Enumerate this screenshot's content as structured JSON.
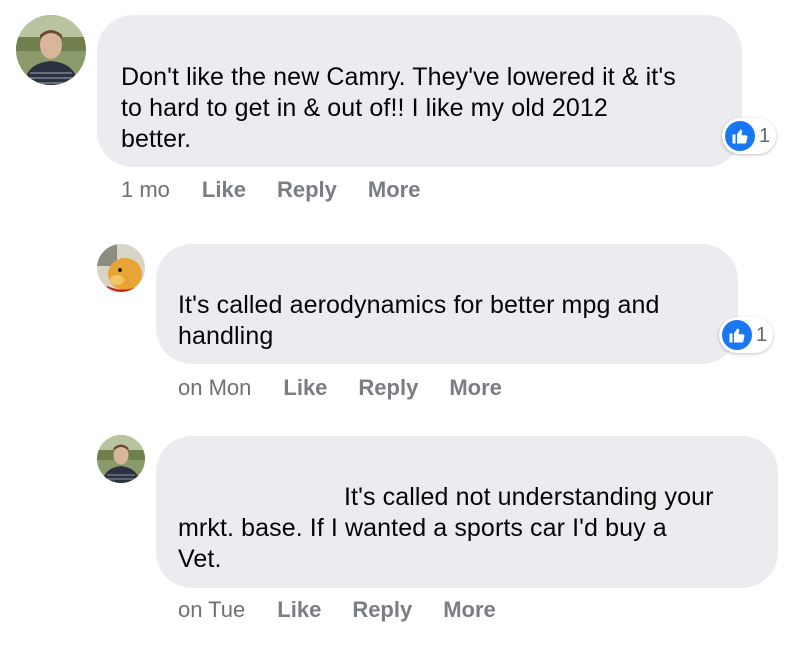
{
  "colors": {
    "bubble": "#ebecf0",
    "like_blue": "#1877f2",
    "meta_text": "#65676b"
  },
  "comments": [
    {
      "avatar_icon": "person-photo-avatar",
      "lines": [
        "Don't like the new Camry. They've lowered it & it's",
        "to hard to get in & out of!! I like my old 2012",
        "better."
      ],
      "reaction_icon": "thumbs-up-icon",
      "reaction_count": "1",
      "time": "1 mo",
      "like_label": "Like",
      "reply_label": "Reply",
      "more_label": "More"
    },
    {
      "avatar_icon": "cartoon-bear-avatar",
      "lines": [
        "It's called aerodynamics for better mpg and",
        "handling"
      ],
      "reaction_icon": "thumbs-up-icon",
      "reaction_count": "1",
      "time": "on Mon",
      "like_label": "Like",
      "reply_label": "Reply",
      "more_label": "More"
    },
    {
      "avatar_icon": "person-photo-avatar",
      "lines": [
        "It's called not understanding your",
        "mrkt. base. If I wanted a sports car I'd buy a",
        "Vet."
      ],
      "time": "on Tue",
      "like_label": "Like",
      "reply_label": "Reply",
      "more_label": "More"
    }
  ]
}
